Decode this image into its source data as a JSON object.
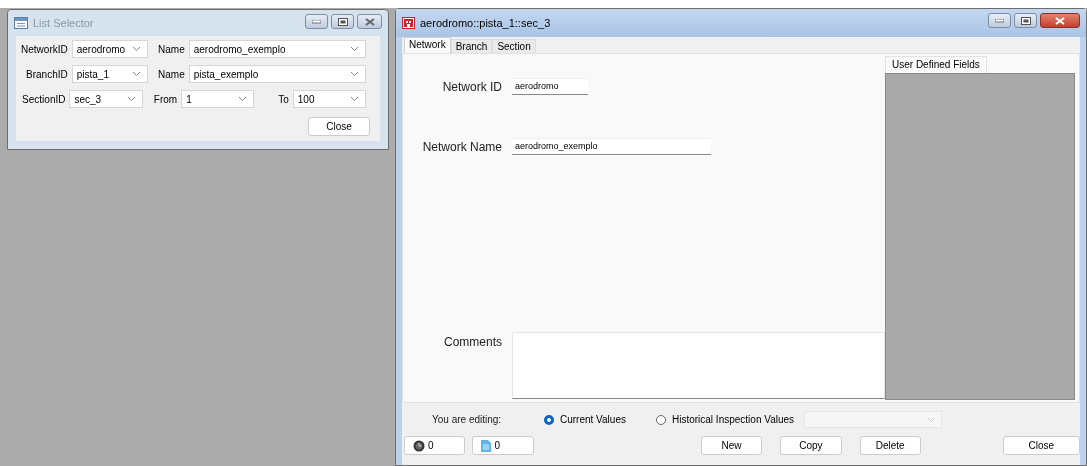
{
  "list_selector": {
    "title": "List Selector",
    "active": false,
    "rows": [
      {
        "items": [
          {
            "label": "NetworkID",
            "value": "aerodromo"
          },
          {
            "label": "Name",
            "value": "aerodromo_exemplo"
          }
        ]
      },
      {
        "items": [
          {
            "label": "BranchID",
            "value": "pista_1"
          },
          {
            "label": "Name",
            "value": "pista_exemplo"
          }
        ]
      },
      {
        "items": [
          {
            "label": "SectionID",
            "value": "sec_3"
          },
          {
            "label": "From",
            "value": "1"
          },
          {
            "label": "To",
            "value": "100"
          }
        ]
      }
    ],
    "close_button": "Close"
  },
  "editor": {
    "title": "aerodromo::pista_1::sec_3",
    "active": true,
    "tabs": [
      {
        "label": "Network",
        "selected": true
      },
      {
        "label": "Branch",
        "selected": false
      },
      {
        "label": "Section",
        "selected": false
      }
    ],
    "fields": [
      {
        "label": "Network ID",
        "value": "aerodromo"
      },
      {
        "label": "Network Name",
        "value": "aerodromo_exemplo"
      }
    ],
    "comments": {
      "label": "Comments"
    },
    "udf_tab": "User Defined Fields",
    "editing_label": "You are editing:",
    "radios": [
      {
        "label": "Current Values",
        "selected": true
      },
      {
        "label": "Historical Inspection Values",
        "selected": false
      }
    ],
    "history_dropdown": {
      "disabled": true
    },
    "counters": [
      {
        "kind": "clock",
        "value": "0"
      },
      {
        "kind": "document",
        "value": "0"
      }
    ],
    "buttons": [
      {
        "label": "New",
        "kind": "action"
      },
      {
        "label": "Copy",
        "kind": "action"
      },
      {
        "label": "Delete",
        "kind": "action"
      },
      {
        "label": "Close",
        "kind": "close"
      }
    ]
  }
}
